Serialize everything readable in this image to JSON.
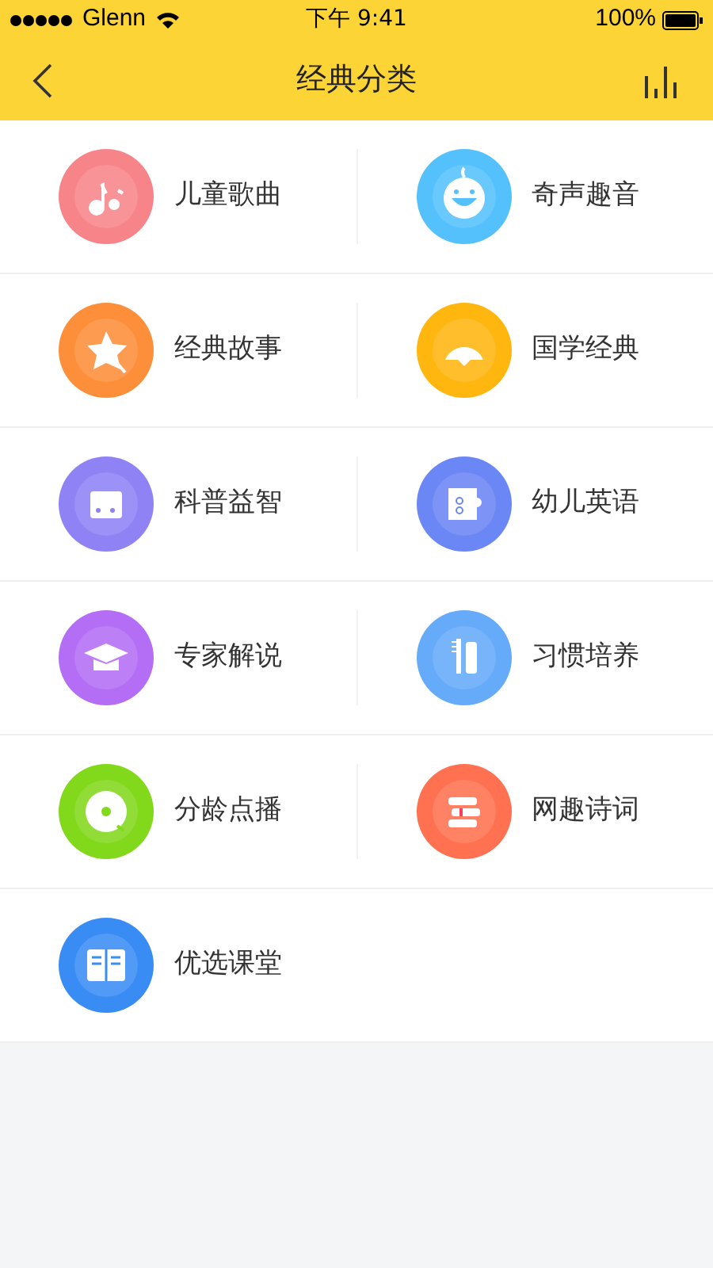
{
  "status_bar": {
    "carrier": "Glenn",
    "time": "下午 9:41",
    "battery": "100%"
  },
  "nav": {
    "title": "经典分类"
  },
  "categories": [
    {
      "label": "儿童歌曲",
      "kind": "note",
      "color": "#f78489"
    },
    {
      "label": "奇声趣音",
      "kind": "face",
      "color": "#55c1fc"
    },
    {
      "label": "经典故事",
      "kind": "star",
      "color": "#fd8f3a"
    },
    {
      "label": "国学经典",
      "kind": "fan",
      "color": "#ffb70f"
    },
    {
      "label": "科普益智",
      "kind": "beaker",
      "color": "#8f82f5"
    },
    {
      "label": "幼儿英语",
      "kind": "card",
      "color": "#6b86f5"
    },
    {
      "label": "专家解说",
      "kind": "cap",
      "color": "#b46ef5"
    },
    {
      "label": "习惯培养",
      "kind": "brush",
      "color": "#66aafa"
    },
    {
      "label": "分龄点播",
      "kind": "disc",
      "color": "#82d81b"
    },
    {
      "label": "网趣诗词",
      "kind": "books",
      "color": "#ff7150"
    },
    {
      "label": "优选课堂",
      "kind": "book",
      "color": "#3a8cf5"
    }
  ]
}
